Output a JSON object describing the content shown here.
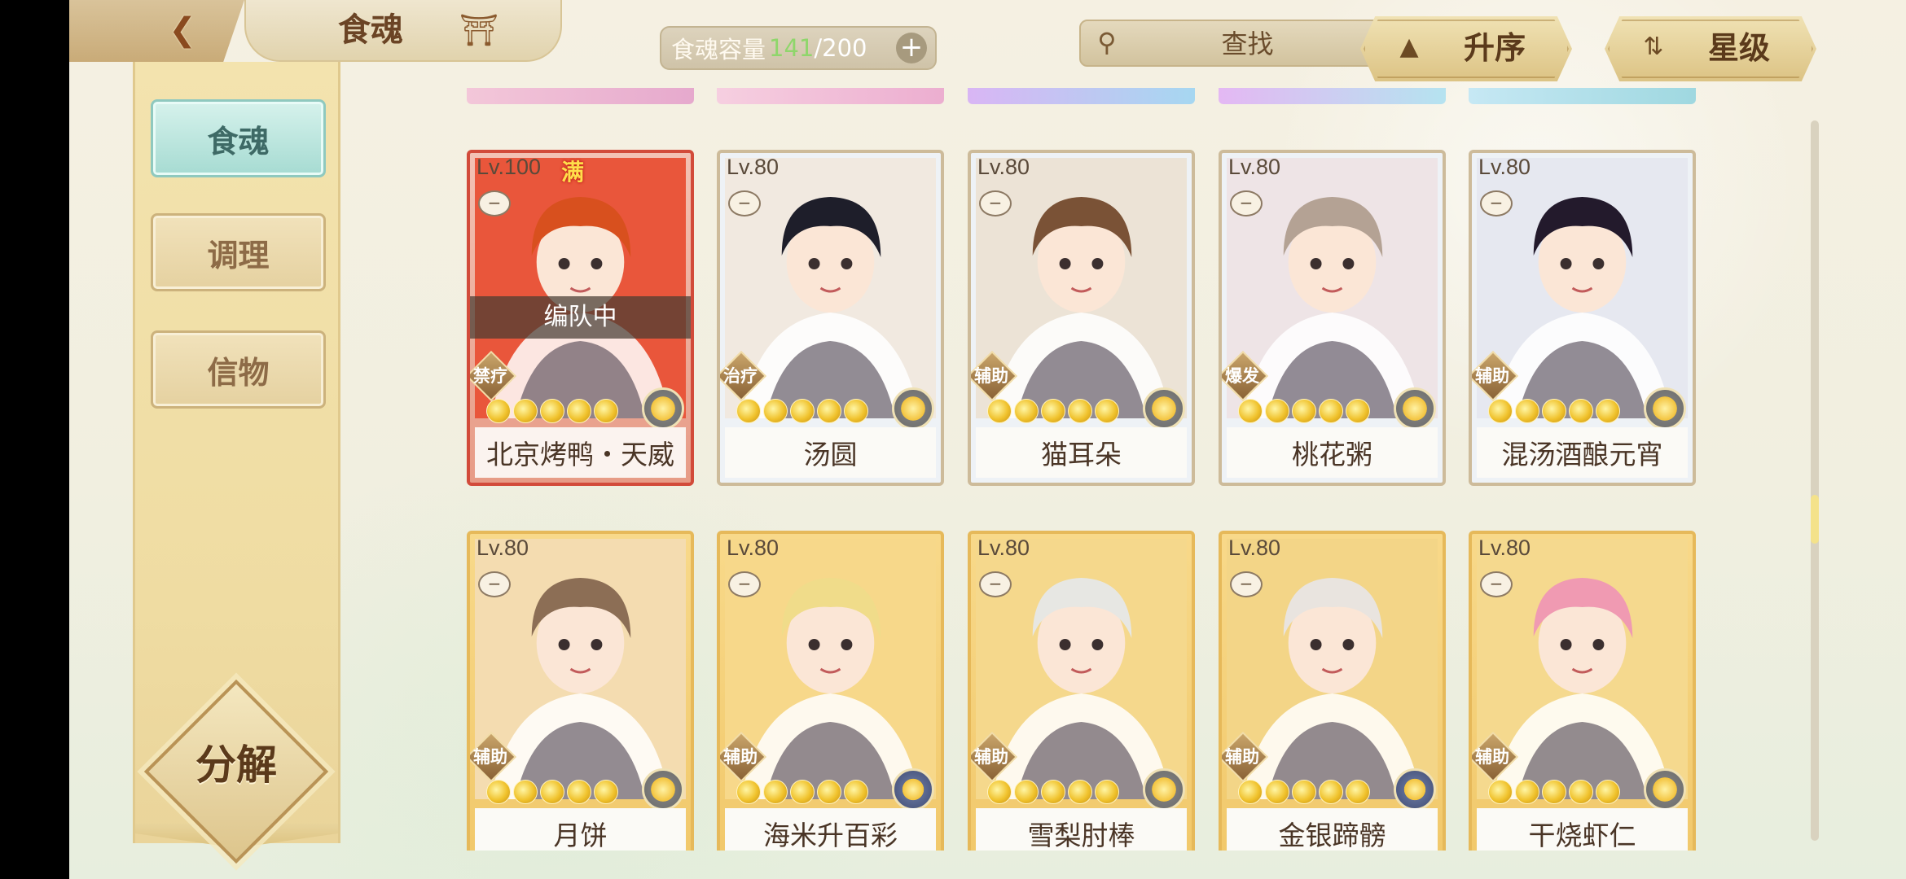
{
  "header": {
    "title": "食魂",
    "capacity": {
      "label": "食魂容量",
      "current": "141",
      "separator": "/",
      "max": "200"
    },
    "search": {
      "placeholder": "查找"
    },
    "sort_order": {
      "label": "升序"
    },
    "sort_field": {
      "label": "星级"
    }
  },
  "sidebar": {
    "tabs": [
      {
        "label": "食魂",
        "active": true
      },
      {
        "label": "调理",
        "active": false
      },
      {
        "label": "信物",
        "active": false
      }
    ],
    "decompose_label": "分解"
  },
  "cards": [
    {
      "level": "Lv.100",
      "full_badge": "满",
      "status": "编队中",
      "role": "禁疗",
      "name": "北京烤鸭・天威",
      "stars": 5,
      "frame": "red",
      "hair": "#d8501e",
      "bg": "#e9563b",
      "orb": "gold"
    },
    {
      "level": "Lv.80",
      "role": "治疗",
      "name": "汤圆",
      "stars": 5,
      "frame": "silver",
      "hair": "#1e1e2a",
      "bg": "#f1e9e0",
      "orb": "gold"
    },
    {
      "level": "Lv.80",
      "role": "辅助",
      "name": "猫耳朵",
      "stars": 5,
      "frame": "silver",
      "hair": "#7a5236",
      "bg": "#ece3d6",
      "orb": "gold"
    },
    {
      "level": "Lv.80",
      "role": "爆发",
      "name": "桃花粥",
      "stars": 5,
      "frame": "silver",
      "hair": "#b4a294",
      "bg": "#eee4e6",
      "orb": "gold"
    },
    {
      "level": "Lv.80",
      "role": "辅助",
      "name": "混汤酒酿元宵",
      "stars": 5,
      "frame": "silver",
      "hair": "#231a2c",
      "bg": "#e6e8f0",
      "orb": "gold"
    },
    {
      "level": "Lv.80",
      "role": "辅助",
      "name": "月饼",
      "stars": 5,
      "frame": "gold",
      "hair": "#8c6e55",
      "bg": "#f4dcb0",
      "orb": "gold"
    },
    {
      "level": "Lv.80",
      "role": "辅助",
      "name": "海米升百彩",
      "stars": 5,
      "frame": "gold",
      "hair": "#f0dc8a",
      "bg": "#f7d88a",
      "orb": "blue"
    },
    {
      "level": "Lv.80",
      "role": "辅助",
      "name": "雪梨肘棒",
      "stars": 5,
      "frame": "gold",
      "hair": "#e7e7e3",
      "bg": "#f5d88c",
      "orb": "gold"
    },
    {
      "level": "Lv.80",
      "role": "辅助",
      "name": "金银蹄髈",
      "stars": 5,
      "frame": "gold",
      "hair": "#e9e4df",
      "bg": "#f3d587",
      "orb": "blue"
    },
    {
      "level": "Lv.80",
      "role": "辅助",
      "name": "干烧虾仁",
      "stars": 5,
      "frame": "gold",
      "hair": "#f09ab2",
      "bg": "#f5d98e",
      "orb": "gold"
    }
  ],
  "colors": {
    "accent_tab": "#a6dbd2",
    "gold_frame": "#e6b95a",
    "red_frame": "#d24b3a",
    "capacity_current": "#8fd66b"
  }
}
